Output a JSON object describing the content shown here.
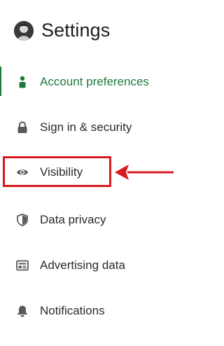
{
  "header": {
    "title": "Settings",
    "avatar_icon": "avatar-icon"
  },
  "nav": {
    "items": [
      {
        "label": "Account preferences",
        "icon": "person-icon",
        "active": true
      },
      {
        "label": "Sign in & security",
        "icon": "lock-icon",
        "active": false
      },
      {
        "label": "Visibility",
        "icon": "eye-icon",
        "active": false
      },
      {
        "label": "Data privacy",
        "icon": "shield-icon",
        "active": false
      },
      {
        "label": "Advertising data",
        "icon": "ad-card-icon",
        "active": false
      },
      {
        "label": "Notifications",
        "icon": "bell-icon",
        "active": false
      }
    ]
  },
  "annotation": {
    "highlight_color": "#d71920",
    "target": "Visibility"
  },
  "colors": {
    "active": "#1c7a3c",
    "text": "#2a2a2a",
    "icon": "#5a5a5a"
  }
}
